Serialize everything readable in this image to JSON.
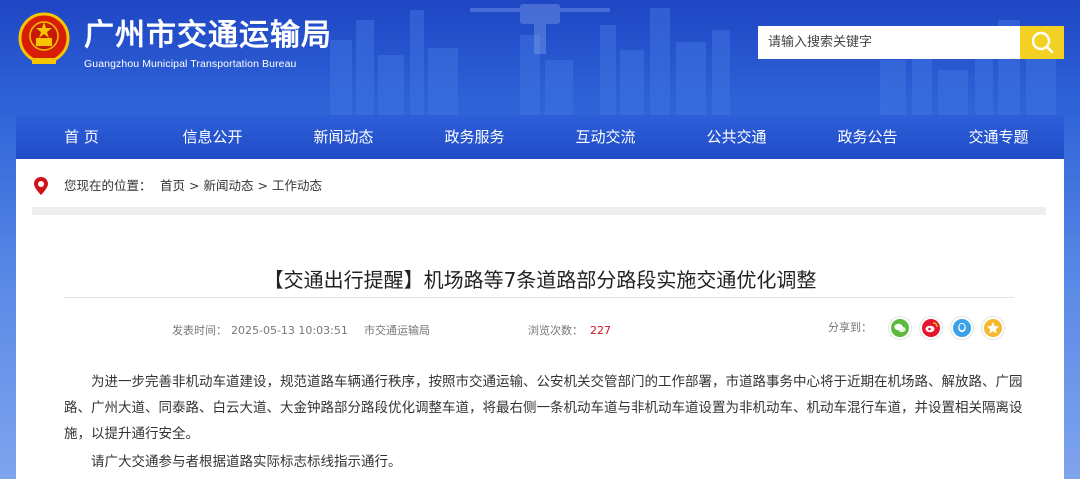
{
  "header": {
    "title": "广州市交通运输局",
    "subtitle": "Guangzhou Municipal Transportation Bureau",
    "emblem_icon": "national-emblem-icon"
  },
  "search": {
    "placeholder": "请输入搜索关键字",
    "button_icon": "search-icon",
    "button_color": "#f3d124"
  },
  "nav": {
    "items": [
      "首 页",
      "信息公开",
      "新闻动态",
      "政务服务",
      "互动交流",
      "公共交通",
      "政务公告",
      "交通专题"
    ],
    "background": "#2355d0"
  },
  "breadcrumb": {
    "label": "您现在的位置：",
    "items": [
      "首页",
      "新闻动态",
      "工作动态"
    ],
    "separator": ">",
    "icon": "location-pin-icon"
  },
  "article": {
    "title": "【交通出行提醒】机场路等7条道路部分路段实施交通优化调整",
    "publish_label": "发表时间：",
    "publish_time": "2025-05-13 10:03:51",
    "source": "市交通运输局",
    "views_label": "浏览次数：",
    "views": "227",
    "share_label": "分享到：",
    "share_icons": [
      "wechat-icon",
      "weibo-icon",
      "qq-icon",
      "qzone-icon"
    ],
    "paragraphs": [
      "为进一步完善非机动车道建设，规范道路车辆通行秩序，按照市交通运输、公安机关交管部门的工作部署，市道路事务中心将于近期在机场路、解放路、广园路、广州大道、同泰路、白云大道、大金钟路部分路段优化调整车道，将最右侧一条机动车道与非机动车道设置为非机动车、机动车混行车道，并设置相关隔离设施，以提升通行安全。",
      "请广大交通参与者根据道路实际标志标线指示通行。"
    ]
  },
  "colors": {
    "accent_red": "#d0121b",
    "wechat_green": "#5dbb3c",
    "weibo_red": "#e6162d",
    "qq_blue": "#3aa2e8",
    "qzone_yellow": "#f5b82e"
  }
}
